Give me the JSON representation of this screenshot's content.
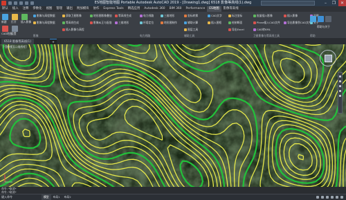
{
  "window": {
    "title": "ES地图智能地图 Portable Autodesk AutoCAD 2019 - [Drawing1.dwg]    6518 影像等高线(1).dwg",
    "min": "–",
    "max": "❐",
    "close": "✕"
  },
  "menu": {
    "tabs": [
      "默认",
      "插入",
      "注释",
      "参数化",
      "视图",
      "管理",
      "输出",
      "附加模块",
      "协作",
      "Express Tools",
      "精选应用",
      "Autodesk 360",
      "BIM 360",
      "Performance",
      "ES地图",
      "影像等高线"
    ],
    "active_index": 14
  },
  "ribbon": {
    "buttons": [
      {
        "label": "新建",
        "color": "#4aa3df"
      },
      {
        "label": "打开",
        "color": "#e8b84a"
      },
      {
        "label": "插入影像",
        "color": "#5fb85f"
      },
      {
        "label": "CAD地图",
        "color": "#d9534f"
      },
      {
        "label": "设置",
        "color": "#7d8a99"
      }
    ],
    "groups": [
      {
        "label": "影像",
        "items": [
          "影像与高程数据",
          "影像与高程数据"
        ]
      },
      {
        "label": "",
        "items": [
          "获取卫星影像",
          "等高线生成",
          "插入影像与高程"
        ]
      },
      {
        "label": "",
        "items": [
          "地形图影像叠加",
          "影像纠正与配准"
        ]
      },
      {
        "label": "",
        "items": [
          "等高线生成",
          "三维地形"
        ]
      },
      {
        "label": "电力线路",
        "items": [
          "电力线路",
          "杆塔定位"
        ]
      },
      {
        "label": "",
        "items": [
          "三维地形",
          "地形图制作"
        ]
      },
      {
        "label": "辅助工具",
        "items": [
          "坐标转换",
          "辅助计算",
          "图层工具"
        ]
      },
      {
        "label": "",
        "items": [
          "CAD文字",
          "插入图框"
        ]
      },
      {
        "label": "",
        "items": [
          "标注坐标",
          "绘制断面",
          "导出Excel"
        ]
      },
      {
        "label": "卫星影像与等高线工具",
        "items": [
          "批量插入影像",
          "Plane插入CAD文件",
          "CAD转KML"
        ]
      },
      {
        "label": "",
        "items": [
          "插入影像",
          "导出影像到CAD文件"
        ]
      },
      {
        "label": "帮助",
        "items": [
          "说明",
          "关于"
        ]
      }
    ],
    "side_buttons": [
      {
        "label": "",
        "color": "#4aa3df"
      },
      {
        "label": "",
        "color": "#3d8fd6"
      },
      {
        "label": "帮助与关于",
        "color": "#5a6370"
      }
    ]
  },
  "doc_tabs": [
    {
      "label": "6518 影像等高线(1)",
      "active": false
    },
    {
      "label": "+",
      "active": true
    }
  ],
  "viewport": {
    "label": "[-][俯视][二维线框]",
    "view_direction": "上"
  },
  "command_line": {
    "lines": [
      "命令: *取消*",
      "命令: *取消*"
    ],
    "prompt": "键入命令"
  },
  "status": {
    "layout_tabs": [
      "模型",
      "布局1",
      "布局2"
    ],
    "active_layout": 0,
    "mode_text": "模型"
  },
  "colors": {
    "contour_index": "#22c23a",
    "contour_intermediate": "#e6e84a",
    "terrain_dark": "#1b2a17",
    "terrain_light": "#4d6b3a"
  }
}
